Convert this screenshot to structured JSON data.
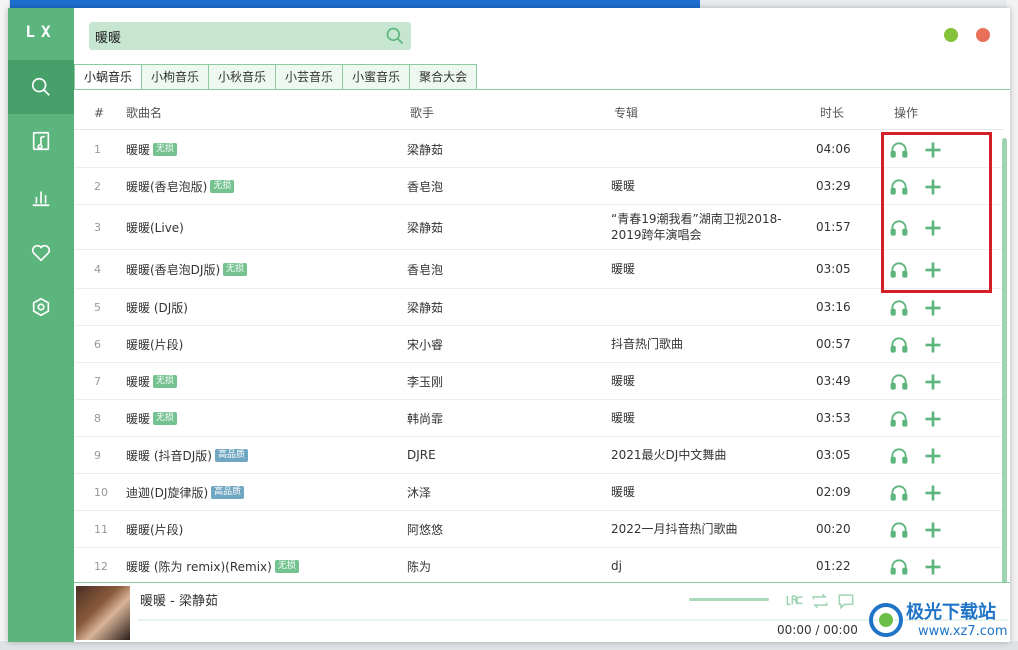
{
  "app": {
    "logo": "LX"
  },
  "search": {
    "value": "暖暖"
  },
  "colors": {
    "accent": "#5cb57d",
    "highlight": "#d41f26",
    "badge_lossless": "#73c28f",
    "badge_hq": "#6fa6c2"
  },
  "sources": [
    "小蜗音乐",
    "小枸音乐",
    "小秋音乐",
    "小芸音乐",
    "小蜜音乐",
    "聚合大会"
  ],
  "columns": {
    "index": "#",
    "title": "歌曲名",
    "artist": "歌手",
    "album": "专辑",
    "duration": "时长",
    "actions": "操作"
  },
  "songs": [
    {
      "no": "1",
      "title": "暖暖",
      "badge": "无损",
      "artist": "梁静茹",
      "album": "",
      "duration": "04:06"
    },
    {
      "no": "2",
      "title": "暖暖(香皂泡版)",
      "badge": "无损",
      "artist": "香皂泡",
      "album": "暖暖",
      "duration": "03:29"
    },
    {
      "no": "3",
      "title": "暖暖(Live)",
      "badge": "",
      "artist": "梁静茹",
      "album": "“青春19潮我看”湖南卫视2018-2019跨年演唱会",
      "duration": "01:57"
    },
    {
      "no": "4",
      "title": "暖暖(香皂泡DJ版)",
      "badge": "无损",
      "artist": "香皂泡",
      "album": "暖暖",
      "duration": "03:05"
    },
    {
      "no": "5",
      "title": "暖暖 (DJ版)",
      "badge": "",
      "artist": "梁静茹",
      "album": "",
      "duration": "03:16"
    },
    {
      "no": "6",
      "title": "暖暖(片段)",
      "badge": "",
      "artist": "宋小睿",
      "album": "抖音热门歌曲",
      "duration": "00:57"
    },
    {
      "no": "7",
      "title": "暖暖",
      "badge": "无损",
      "artist": "李玉刚",
      "album": "暖暖",
      "duration": "03:49"
    },
    {
      "no": "8",
      "title": "暖暖",
      "badge": "无损",
      "artist": "韩尚霏",
      "album": "暖暖",
      "duration": "03:53"
    },
    {
      "no": "9",
      "title": "暖暖 (抖音DJ版)",
      "badge": "高品质",
      "artist": "DJRE",
      "album": "2021最火DJ中文舞曲",
      "duration": "03:05"
    },
    {
      "no": "10",
      "title": "迪迦(DJ旋律版)",
      "badge": "高品质",
      "artist": "沐泽",
      "album": "暖暖",
      "duration": "02:09"
    },
    {
      "no": "11",
      "title": "暖暖(片段)",
      "badge": "",
      "artist": "阿悠悠",
      "album": "2022一月抖音热门歌曲",
      "duration": "00:20"
    },
    {
      "no": "12",
      "title": "暖暖 (陈为 remix)(Remix)",
      "badge": "无损",
      "artist": "陈为",
      "album": "dj",
      "duration": "01:22"
    }
  ],
  "player": {
    "title": "暖暖 - 梁静茹",
    "time": "00:00 / 00:00",
    "lrc": "LRC"
  },
  "watermark": {
    "text": "极光下载站",
    "url": "www.xz7.com"
  }
}
